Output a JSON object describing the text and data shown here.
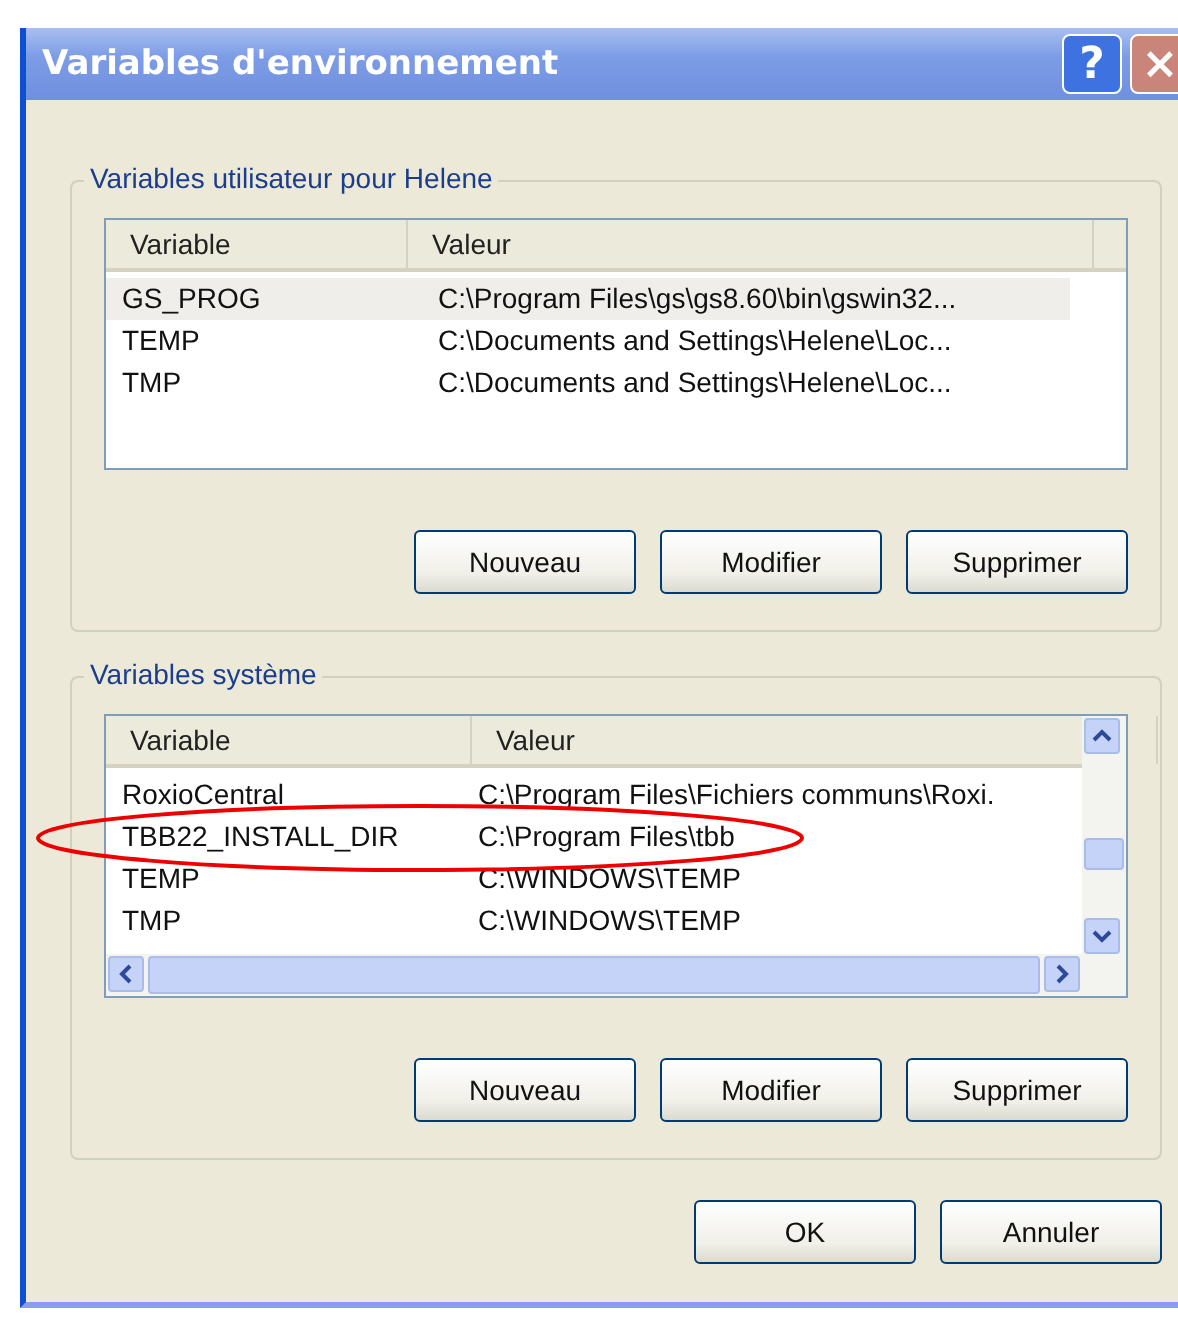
{
  "window": {
    "title": "Variables d'environnement",
    "help_button": "?",
    "close_button": "×"
  },
  "user_group": {
    "title": "Variables utilisateur pour Helene",
    "columns": [
      "Variable",
      "Valeur"
    ],
    "rows": [
      {
        "name": "GS_PROG",
        "value": "C:\\Program Files\\gs\\gs8.60\\bin\\gswin32...",
        "selected": true
      },
      {
        "name": "TEMP",
        "value": "C:\\Documents and Settings\\Helene\\Loc...",
        "selected": false
      },
      {
        "name": "TMP",
        "value": "C:\\Documents and Settings\\Helene\\Loc...",
        "selected": false
      }
    ],
    "buttons": [
      "Nouveau",
      "Modifier",
      "Supprimer"
    ]
  },
  "system_group": {
    "title": "Variables système",
    "columns": [
      "Variable",
      "Valeur"
    ],
    "rows": [
      {
        "name": "RoxioCentral",
        "value": "C:\\Program Files\\Fichiers communs\\Roxi.",
        "selected": false
      },
      {
        "name": "TBB22_INSTALL_DIR",
        "value": "C:\\Program Files\\tbb",
        "selected": false,
        "circled": true
      },
      {
        "name": "TEMP",
        "value": "C:\\WINDOWS\\TEMP",
        "selected": false
      },
      {
        "name": "TMP",
        "value": "C:\\WINDOWS\\TEMP",
        "selected": false
      }
    ],
    "buttons": [
      "Nouveau",
      "Modifier",
      "Supprimer"
    ]
  },
  "buttons": [
    "OK",
    "Annuler"
  ]
}
